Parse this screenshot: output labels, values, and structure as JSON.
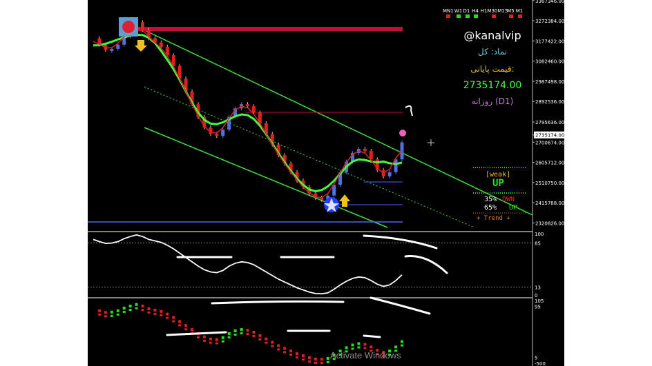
{
  "chart_data": {
    "type": "candlestick",
    "main": {
      "price_axis": [
        "3367346.00",
        "3272384.00",
        "3177422.00",
        "3082460.00",
        "2987498.00",
        "2892536.00",
        "2795636.00",
        "2735174.00",
        "2700674.00",
        "2605712.00",
        "2510750.00",
        "2415788.00",
        "2320826.00"
      ],
      "current_price_label": "2735174.00",
      "y_range": [
        2290000,
        3370000
      ],
      "price_path": [
        3190000,
        3160000,
        3135000,
        3140000,
        3160000,
        3200000,
        3230000,
        3265000,
        3230000,
        3190000,
        3170000,
        3150000,
        3110000,
        3060000,
        3000000,
        2940000,
        2880000,
        2820000,
        2770000,
        2740000,
        2730000,
        2760000,
        2820000,
        2860000,
        2880000,
        2870000,
        2840000,
        2790000,
        2740000,
        2690000,
        2640000,
        2600000,
        2560000,
        2520000,
        2490000,
        2460000,
        2440000,
        2430000,
        2450000,
        2500000,
        2560000,
        2610000,
        2650000,
        2670000,
        2660000,
        2620000,
        2570000,
        2540000,
        2560000,
        2620000,
        2700000
      ]
    },
    "oscillator_1": {
      "levels": [
        "100",
        "85",
        "13",
        "0"
      ],
      "y_range": [
        0,
        100
      ]
    },
    "oscillator_2": {
      "levels": [
        "105",
        "95",
        "5",
        "-500"
      ]
    }
  },
  "timeframes": [
    "MN1",
    "W1",
    "D1",
    "H4",
    "H1M30M15",
    "M5",
    "M1"
  ],
  "timeframe_colors": [
    "#e02020",
    "#20e020",
    "#20e020",
    "#20e020",
    "#e02020",
    "#e02020",
    "#e02020"
  ],
  "info": {
    "handle": "@kanalvip",
    "symbol": "نماد: کل",
    "close_label": "قیمت پایانی:",
    "close_value": "2735174.00",
    "period": "روزانه (D1)"
  },
  "signal": {
    "weak_label": "[weak]",
    "direction": "UP",
    "down_pct": "35%",
    "down_label": "DWN",
    "up_pct": "65%",
    "up_label": "UP",
    "trend_label": "+ Trend +"
  },
  "os_watermark": "Activate Windows",
  "colors": {
    "bull": "#5070e0",
    "bear": "#e02020",
    "fast_ma": "#e02020",
    "slow_ma": "#40ff40",
    "channel": "#40e040",
    "resistance": "#c0103a"
  }
}
